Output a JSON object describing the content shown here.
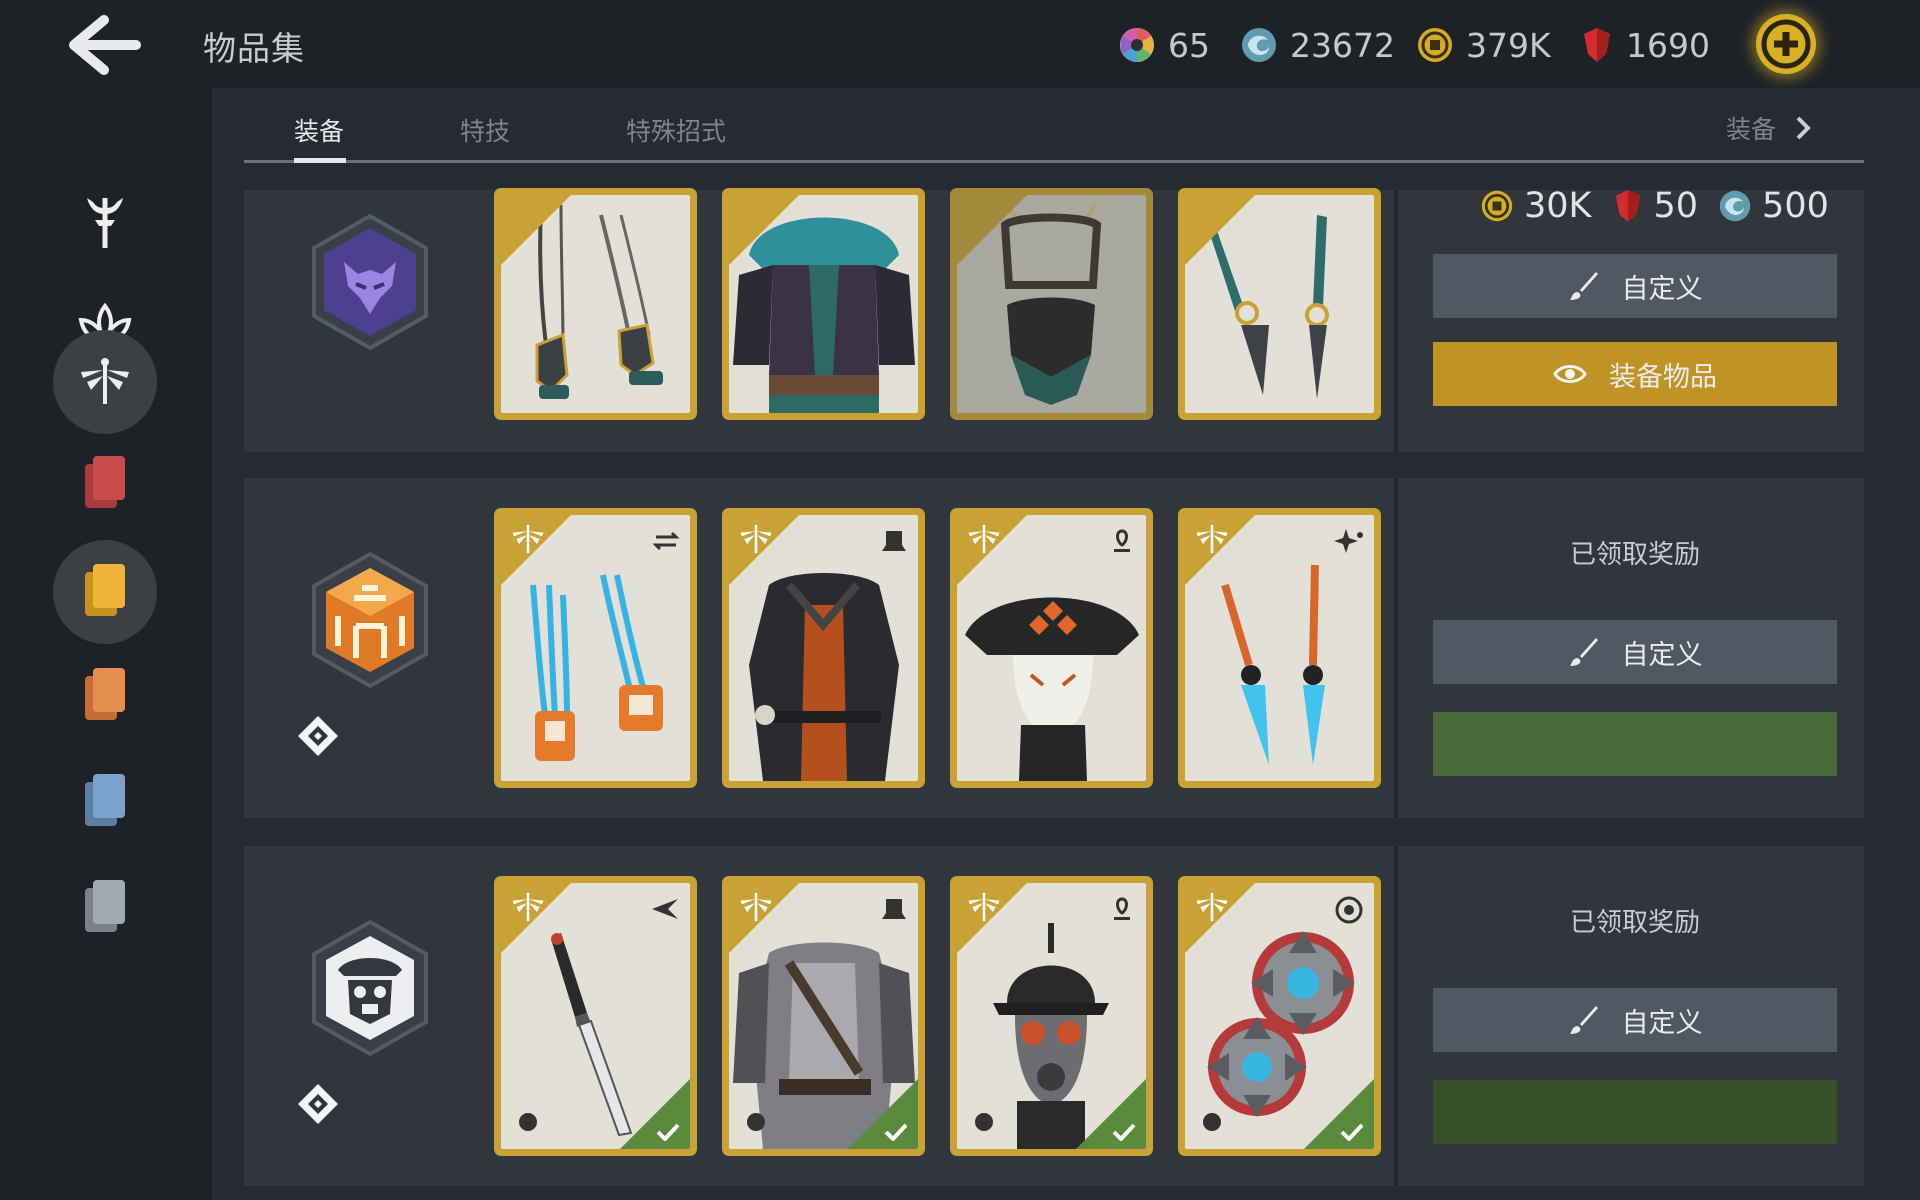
{
  "header": {
    "back_label": "",
    "title": "物品集",
    "currencies": [
      {
        "name": "orbs",
        "value": "65"
      },
      {
        "name": "spirit",
        "value": "23672"
      },
      {
        "name": "coins",
        "value": "379K"
      },
      {
        "name": "gems",
        "value": "1690"
      }
    ]
  },
  "sidebar": {
    "items": [
      {
        "icon": "trident-icon"
      },
      {
        "icon": "lotus-icon"
      },
      {
        "icon": "dragonfly-icon",
        "active": true
      },
      {
        "icon": "cards-red-icon"
      },
      {
        "icon": "cards-yellow-icon",
        "active": true
      },
      {
        "icon": "cards-orange-icon"
      },
      {
        "icon": "cards-blue-icon"
      },
      {
        "icon": "cards-gray-icon"
      }
    ]
  },
  "tabs": {
    "items": [
      "装备",
      "特技",
      "特殊招式"
    ],
    "active": "装备",
    "more_label": "装备"
  },
  "sets": [
    {
      "cost": {
        "coins": "30K",
        "gems": "50",
        "spirit": "500"
      },
      "customize_label": "自定义",
      "equip_label": "装备物品"
    },
    {
      "status": "已领取奖励",
      "customize_label": "自定义"
    },
    {
      "status": "已领取奖励",
      "customize_label": "自定义"
    }
  ],
  "colors": {
    "card_gold": "#c9a236",
    "equip_button": "#c09325",
    "customize_button": "#515863",
    "reward_green": "#4a6a3a",
    "accent_plus": "#d8b025"
  }
}
